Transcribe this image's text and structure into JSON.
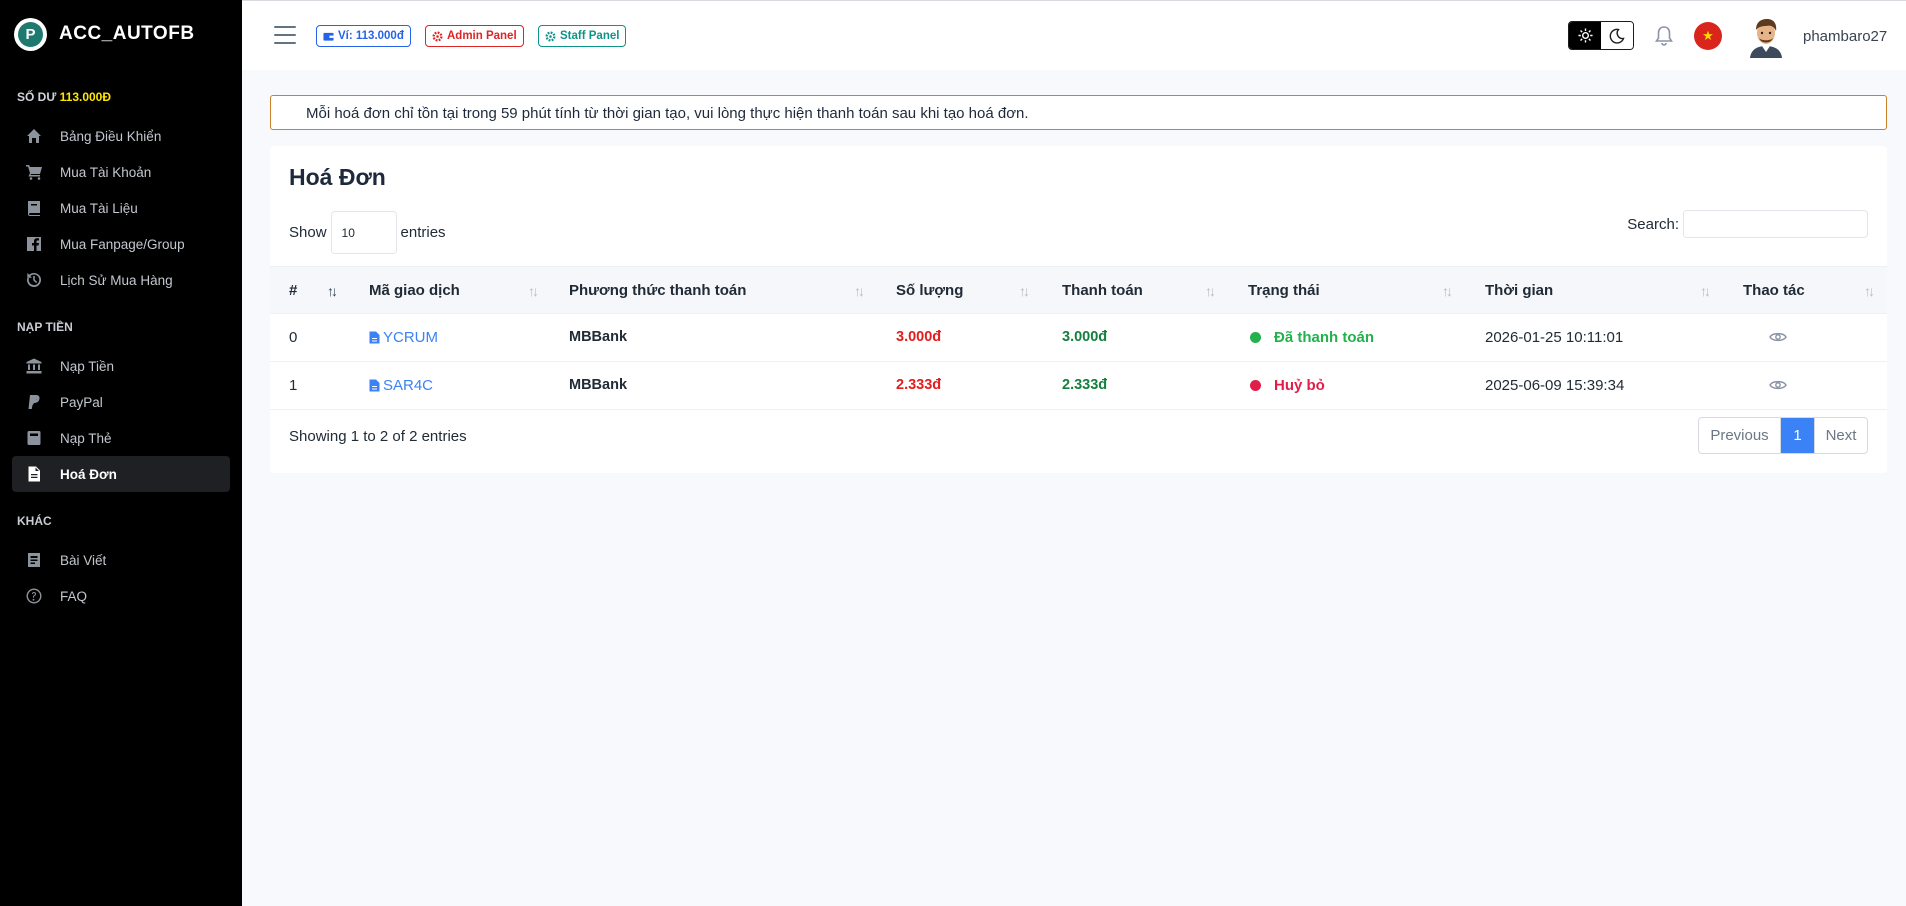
{
  "brand": {
    "name": "ACC_AUTOFB",
    "logo_letter": "P"
  },
  "balance": {
    "label": "SỐ DƯ",
    "amount": "113.000Đ"
  },
  "sidebar": {
    "main_items": [
      {
        "label": "Bảng Điều Khiển",
        "icon": "home-icon"
      },
      {
        "label": "Mua Tài Khoản",
        "icon": "cart-icon"
      },
      {
        "label": "Mua Tài Liệu",
        "icon": "book-icon"
      },
      {
        "label": "Mua Fanpage/Group",
        "icon": "facebook-icon"
      },
      {
        "label": "Lịch Sử Mua Hàng",
        "icon": "history-icon"
      }
    ],
    "section_deposit": "NẠP TIỀN",
    "deposit_items": [
      {
        "label": "Nạp Tiền",
        "icon": "bank-icon"
      },
      {
        "label": "PayPal",
        "icon": "paypal-icon"
      },
      {
        "label": "Nạp Thẻ",
        "icon": "card-icon"
      },
      {
        "label": "Hoá Đơn",
        "icon": "invoice-icon"
      }
    ],
    "section_other": "KHÁC",
    "other_items": [
      {
        "label": "Bài Viết",
        "icon": "blog-icon"
      },
      {
        "label": "FAQ",
        "icon": "question-icon"
      }
    ],
    "active": "Hoá Đơn"
  },
  "header": {
    "wallet_chip": "Ví: 113.000đ",
    "admin_chip": "Admin Panel",
    "staff_chip": "Staff Panel",
    "username": "phambaro27"
  },
  "notice": "Mỗi hoá đơn chỉ tồn tại trong 59 phút tính từ thời gian tạo, vui lòng thực hiện thanh toán sau khi tạo hoá đơn.",
  "card": {
    "title": "Hoá Đơn",
    "show_label": "Show",
    "entries_value": "10",
    "entries_label": "entries",
    "search_label": "Search:"
  },
  "table": {
    "columns": [
      "#",
      "Mã giao dịch",
      "Phương thức thanh toán",
      "Số lượng",
      "Thanh toán",
      "Trạng thái",
      "Thời gian",
      "Thao tác"
    ],
    "rows": [
      {
        "index": "0",
        "code": "YCRUM",
        "method": "MBBank",
        "amount": "3.000đ",
        "paid": "3.000đ",
        "status": "Đã thanh toán",
        "status_color": "#22b14c",
        "time": "2026-01-25 10:11:01"
      },
      {
        "index": "1",
        "code": "SAR4C",
        "method": "MBBank",
        "amount": "2.333đ",
        "paid": "2.333đ",
        "status": "Huỷ bỏ",
        "status_color": "#e11d48",
        "time": "2025-06-09 15:39:34"
      }
    ]
  },
  "footer": {
    "info": "Showing 1 to 2 of 2 entries",
    "prev": "Previous",
    "page": "1",
    "next": "Next"
  }
}
